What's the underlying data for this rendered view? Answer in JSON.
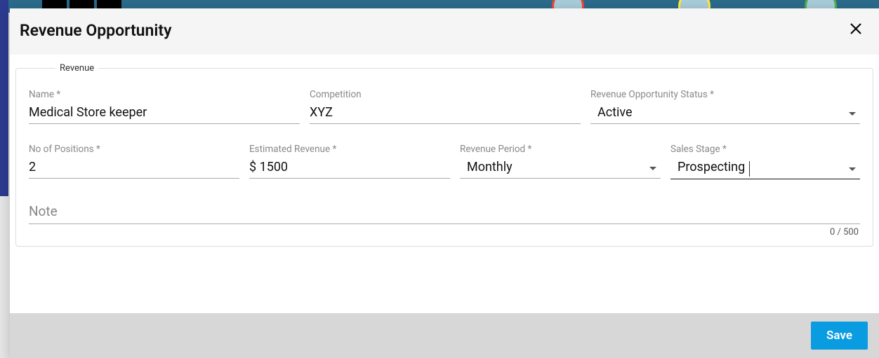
{
  "dialog": {
    "title": "Revenue Opportunity"
  },
  "fieldset": {
    "legend": "Revenue"
  },
  "fields": {
    "name": {
      "label": "Name *",
      "value": "Medical Store keeper"
    },
    "competition": {
      "label": "Competition",
      "value": "XYZ"
    },
    "status": {
      "label": "Revenue Opportunity Status *",
      "value": "Active"
    },
    "positions": {
      "label": "No of Positions *",
      "value": "2"
    },
    "estimated": {
      "label": "Estimated Revenue *",
      "value": "$ 1500"
    },
    "period": {
      "label": "Revenue Period *",
      "value": "Monthly"
    },
    "sales": {
      "label": "Sales Stage *",
      "value": "Prospecting"
    },
    "note": {
      "placeholder": "Note",
      "counter": "0 / 500"
    }
  },
  "actions": {
    "save": "Save"
  }
}
